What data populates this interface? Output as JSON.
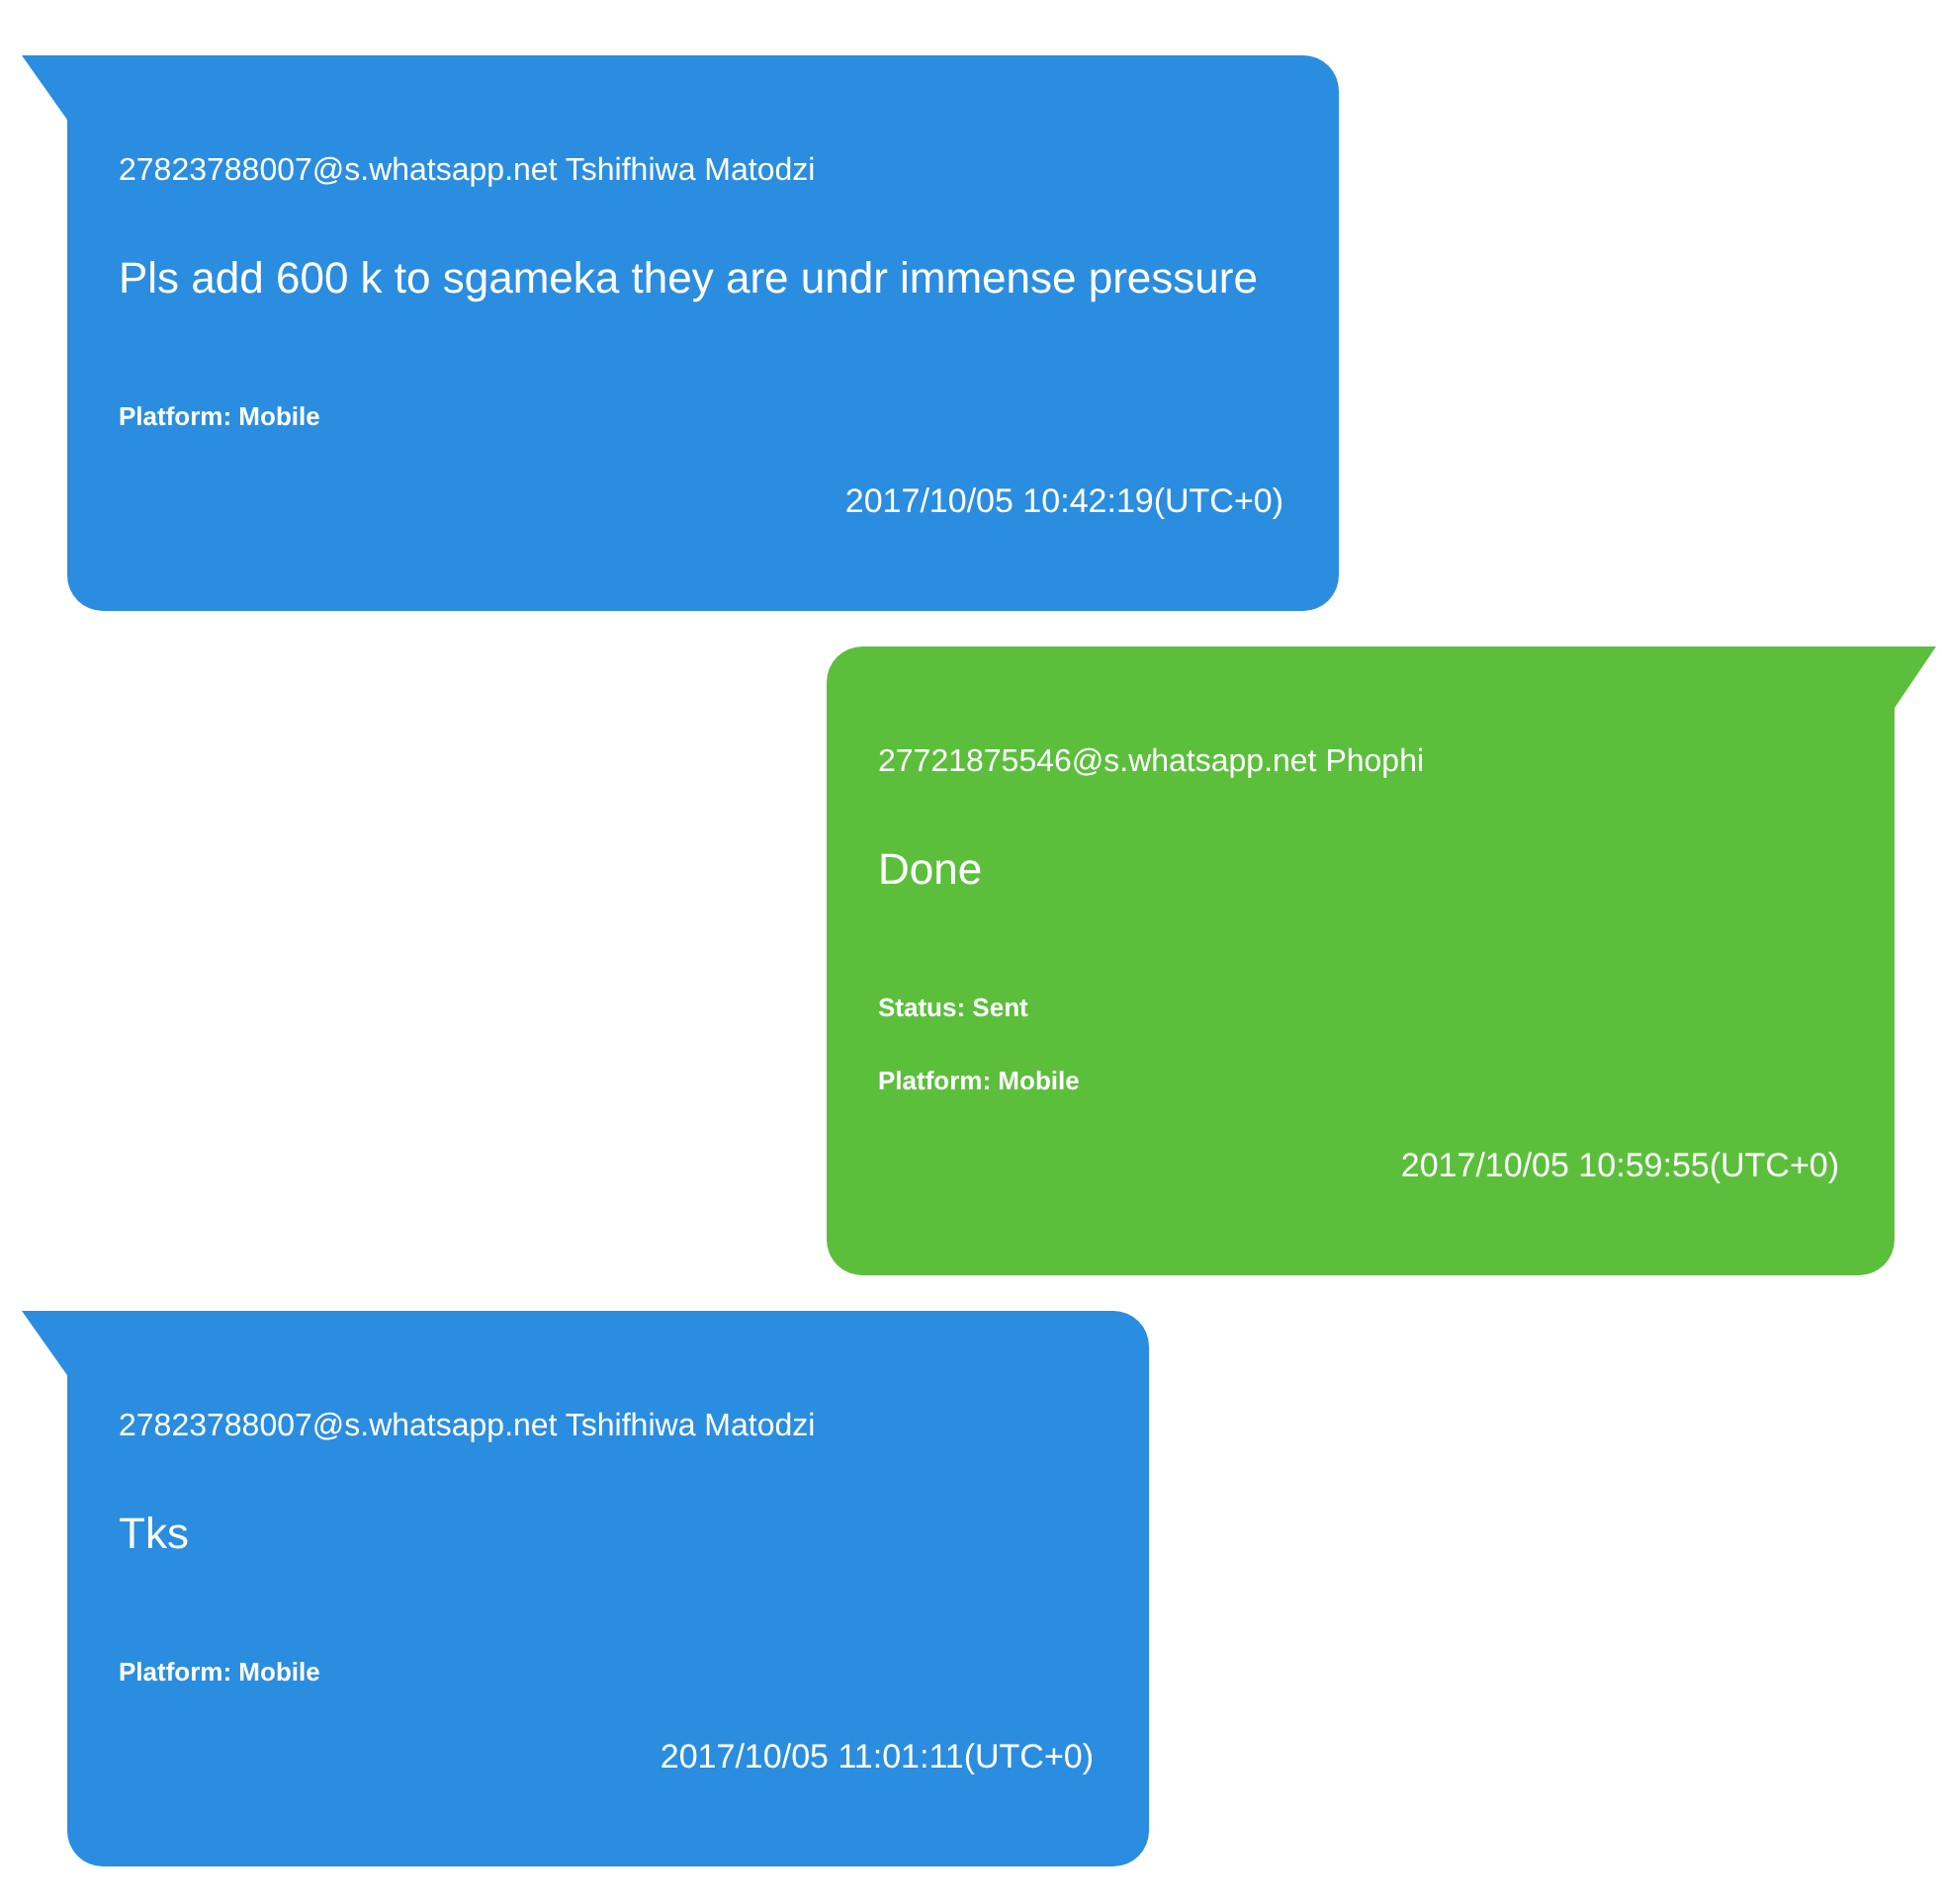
{
  "messages": [
    {
      "kind": "incoming",
      "sender": "27823788007@s.whatsapp.net Tshifhiwa Matodzi",
      "text": "Pls add 600 k to sgameka they are undr immense pressure",
      "details": [
        "Platform: Mobile"
      ],
      "timestamp": "2017/10/05 10:42:19(UTC+0)"
    },
    {
      "kind": "outgoing",
      "sender": "27721875546@s.whatsapp.net Phophi",
      "text": "Done",
      "details": [
        "Status: Sent",
        "Platform: Mobile"
      ],
      "timestamp": "2017/10/05 10:59:55(UTC+0)"
    },
    {
      "kind": "incoming",
      "sender": "27823788007@s.whatsapp.net Tshifhiwa Matodzi",
      "text": "Tks",
      "details": [
        "Platform: Mobile"
      ],
      "timestamp": "2017/10/05 11:01:11(UTC+0)"
    }
  ]
}
